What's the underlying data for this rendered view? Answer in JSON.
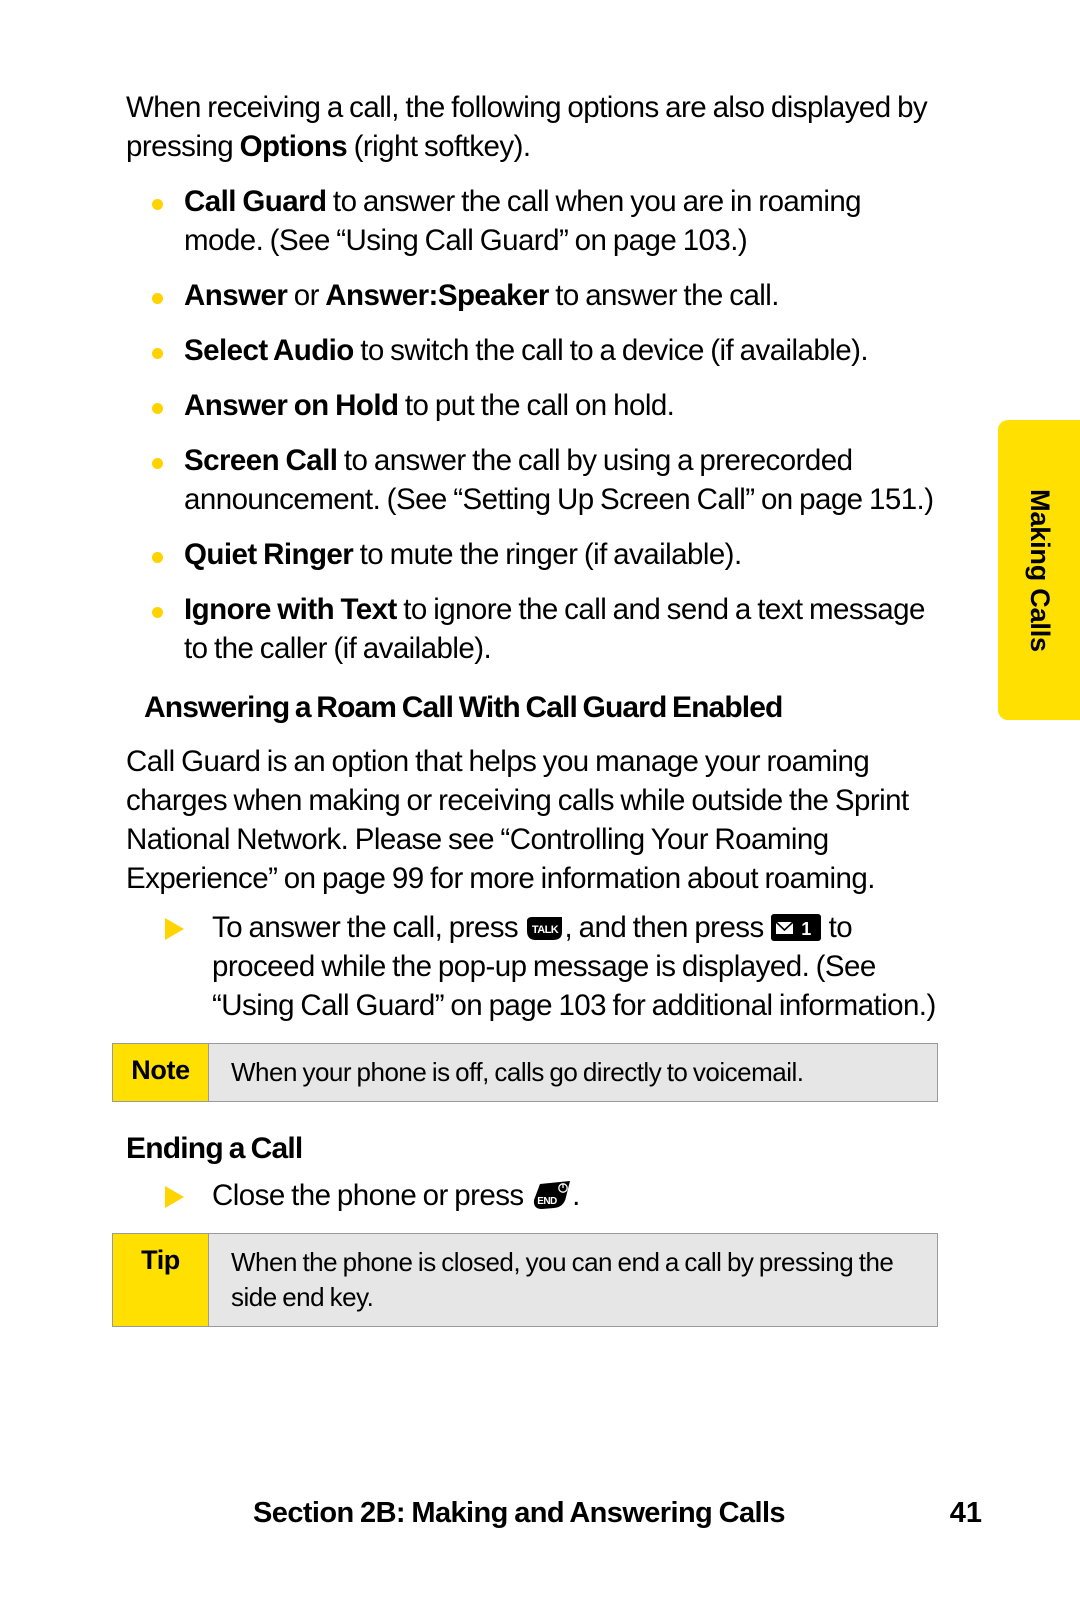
{
  "document": {
    "intro": {
      "before_bold": "When receiving a call, the following options are also displayed by pressing ",
      "bold": "Options",
      "after_bold": " (right softkey)."
    },
    "options_bullets": [
      {
        "bold": "Call Guard",
        "rest": " to answer the call when you are in roaming mode. (See “Using Call Guard” on page 103.)"
      },
      {
        "bold": "Answer",
        "mid": " or ",
        "bold2": "Answer:Speaker",
        "rest": " to answer the call."
      },
      {
        "bold": "Select Audio",
        "rest": " to switch the call to a device (if available)."
      },
      {
        "bold": "Answer on Hold",
        "rest": " to put the call on hold."
      },
      {
        "bold": "Screen Call",
        "rest": " to answer the call by using a prerecorded announcement. (See “Setting Up Screen Call” on page 151.)"
      },
      {
        "bold": "Quiet Ringer",
        "rest": " to mute the ringer (if available)."
      },
      {
        "bold": "Ignore with Text",
        "rest": " to ignore the call and send a text message to the caller (if available)."
      }
    ],
    "heading": "Answering a Roam Call With Call Guard Enabled",
    "roam_paragraph": "Call Guard is an option that helps you manage your roaming charges when making or receiving calls while outside the Sprint National Network. Please see “Controlling Your Roaming Experience” on page 99 for more information about roaming.",
    "roam_step": {
      "part1": "To answer the call, press ",
      "talk_key_label": "TALK",
      "part2": ", and then press ",
      "msg_key_label": "1",
      "part3": " to proceed while the pop-up message is displayed. (See “Using Call Guard” on page 103 for additional information.)"
    },
    "note": {
      "label": "Note",
      "text": "When your phone is off, calls go directly to voicemail."
    },
    "ending_heading": "Ending a Call",
    "ending_step": {
      "part1": "Close the phone or press ",
      "end_key_label": "END",
      "part2": "."
    },
    "tip": {
      "label": "Tip",
      "text": "When the phone is closed, you can end a call by pressing the side end key."
    },
    "side_tab": {
      "label": "Making Calls"
    },
    "footer": {
      "title": "Section 2B: Making and Answering Calls",
      "page_number": "41"
    },
    "colors": {
      "tab_yellow": "#ffe000",
      "bullet_yellow": "#ffd200",
      "arrow_yellow": "#ffd400",
      "callout_gray": "#e6e6e6",
      "callout_border": "#9a9a9a"
    }
  }
}
